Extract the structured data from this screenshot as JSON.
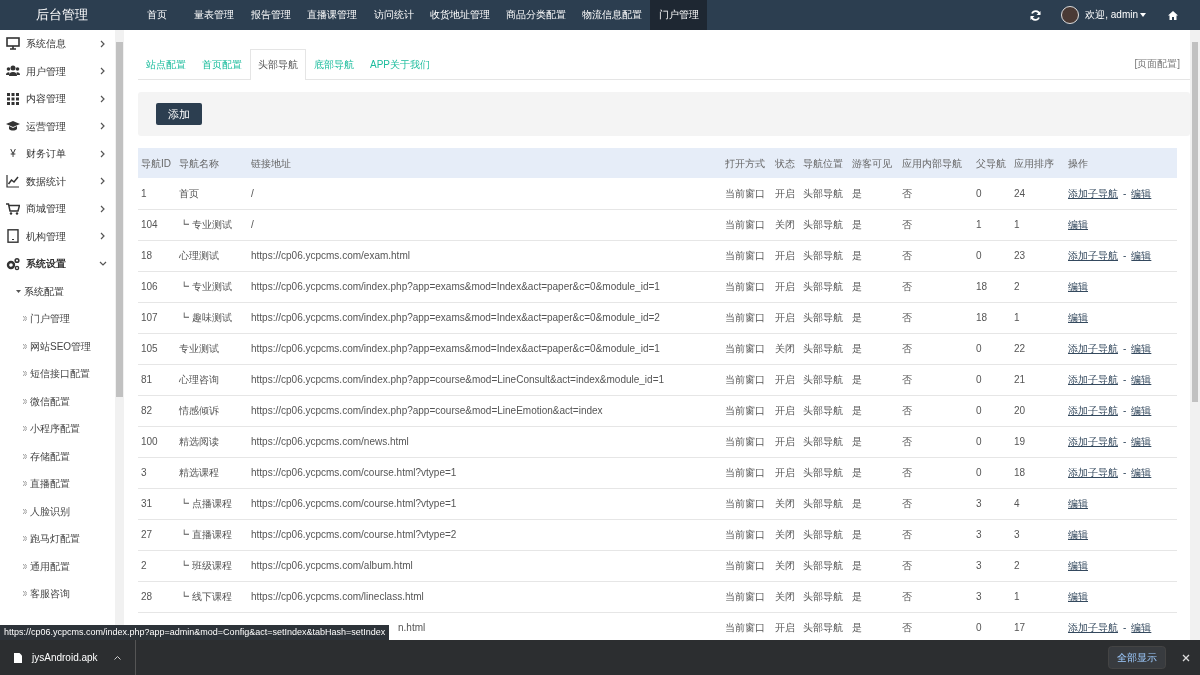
{
  "topbar": {
    "brand": "后台管理",
    "nav": [
      {
        "label": "首页",
        "selected": false
      },
      {
        "label": "量表管理",
        "selected": false
      },
      {
        "label": "报告管理",
        "selected": false
      },
      {
        "label": "直播课管理",
        "selected": false
      },
      {
        "label": "访问统计",
        "selected": false
      },
      {
        "label": "收货地址管理",
        "selected": false
      },
      {
        "label": "商品分类配置",
        "selected": false
      },
      {
        "label": "物流信息配置",
        "selected": false
      },
      {
        "label": "门户管理",
        "selected": true
      }
    ],
    "user": "欢迎, admin"
  },
  "sidebar": {
    "items": [
      {
        "label": "系统信息",
        "expanded": false
      },
      {
        "label": "用户管理",
        "expanded": false
      },
      {
        "label": "内容管理",
        "expanded": false
      },
      {
        "label": "运营管理",
        "expanded": false
      },
      {
        "label": "财务订单",
        "expanded": false,
        "glyph": "¥"
      },
      {
        "label": "数据统计",
        "expanded": false
      },
      {
        "label": "商城管理",
        "expanded": false
      },
      {
        "label": "机构管理",
        "expanded": false
      },
      {
        "label": "系统设置",
        "expanded": true,
        "children": [
          {
            "label": "系统配置",
            "expanded": true,
            "children": [
              {
                "label": "门户管理"
              },
              {
                "label": "网站SEO管理"
              },
              {
                "label": "短信接口配置"
              },
              {
                "label": "微信配置"
              },
              {
                "label": "小程序配置"
              },
              {
                "label": "存储配置"
              },
              {
                "label": "直播配置"
              },
              {
                "label": "人脸识别"
              },
              {
                "label": "跑马灯配置"
              },
              {
                "label": "通用配置"
              },
              {
                "label": "客服咨询"
              }
            ]
          }
        ]
      }
    ]
  },
  "tabs": [
    {
      "label": "站点配置",
      "selected": false
    },
    {
      "label": "首页配置",
      "selected": false
    },
    {
      "label": "头部导航",
      "selected": true
    },
    {
      "label": "底部导航",
      "selected": false
    },
    {
      "label": "APP关于我们",
      "selected": false
    }
  ],
  "page_config": "[页面配置]",
  "add_button": "添加",
  "table": {
    "columns": [
      "导航ID",
      "导航名称",
      "链接地址",
      "打开方式",
      "状态",
      "导航位置",
      "游客可见",
      "应用内部导航",
      "父导航",
      "应用排序",
      "操作"
    ],
    "separator": "-",
    "rows": [
      {
        "id": "1",
        "name": "首页",
        "link": "/",
        "open": "当前窗口",
        "status": "开启",
        "position": "头部导航",
        "guest": "是",
        "internal": "否",
        "parent": "0",
        "order": "24",
        "actions": [
          "添加子导航",
          "编辑"
        ],
        "children": [
          {
            "id": "104",
            "name": "┗ 专业测试",
            "link": "/",
            "open": "当前窗口",
            "status": "关闭",
            "position": "头部导航",
            "guest": "是",
            "internal": "否",
            "parent": "1",
            "order": "1",
            "actions": [
              "编辑"
            ]
          }
        ]
      },
      {
        "id": "18",
        "name": "心理测试",
        "link": "https://cp06.ycpcms.com/exam.html",
        "open": "当前窗口",
        "status": "开启",
        "position": "头部导航",
        "guest": "是",
        "internal": "否",
        "parent": "0",
        "order": "23",
        "actions": [
          "添加子导航",
          "编辑"
        ],
        "children": [
          {
            "id": "106",
            "name": "┗ 专业测试",
            "link": "https://cp06.ycpcms.com/index.php?app=exams&mod=Index&act=paper&c=0&module_id=1",
            "open": "当前窗口",
            "status": "开启",
            "position": "头部导航",
            "guest": "是",
            "internal": "否",
            "parent": "18",
            "order": "2",
            "actions": [
              "编辑"
            ]
          },
          {
            "id": "107",
            "name": "┗ 趣味测试",
            "link": "https://cp06.ycpcms.com/index.php?app=exams&mod=Index&act=paper&c=0&module_id=2",
            "open": "当前窗口",
            "status": "开启",
            "position": "头部导航",
            "guest": "是",
            "internal": "否",
            "parent": "18",
            "order": "1",
            "actions": [
              "编辑"
            ]
          }
        ]
      },
      {
        "id": "105",
        "name": "专业测试",
        "link": "https://cp06.ycpcms.com/index.php?app=exams&mod=Index&act=paper&c=0&module_id=1",
        "open": "当前窗口",
        "status": "关闭",
        "position": "头部导航",
        "guest": "是",
        "internal": "否",
        "parent": "0",
        "order": "22",
        "actions": [
          "添加子导航",
          "编辑"
        ]
      },
      {
        "id": "81",
        "name": "心理咨询",
        "link": "https://cp06.ycpcms.com/index.php?app=course&mod=LineConsult&act=index&module_id=1",
        "open": "当前窗口",
        "status": "开启",
        "position": "头部导航",
        "guest": "是",
        "internal": "否",
        "parent": "0",
        "order": "21",
        "actions": [
          "添加子导航",
          "编辑"
        ]
      },
      {
        "id": "82",
        "name": "情感倾诉",
        "link": "https://cp06.ycpcms.com/index.php?app=course&mod=LineEmotion&act=index",
        "open": "当前窗口",
        "status": "开启",
        "position": "头部导航",
        "guest": "是",
        "internal": "否",
        "parent": "0",
        "order": "20",
        "actions": [
          "添加子导航",
          "编辑"
        ]
      },
      {
        "id": "100",
        "name": "精选阅读",
        "link": "https://cp06.ycpcms.com/news.html",
        "open": "当前窗口",
        "status": "开启",
        "position": "头部导航",
        "guest": "是",
        "internal": "否",
        "parent": "0",
        "order": "19",
        "actions": [
          "添加子导航",
          "编辑"
        ]
      },
      {
        "id": "3",
        "name": "精选课程",
        "link": "https://cp06.ycpcms.com/course.html?vtype=1",
        "open": "当前窗口",
        "status": "开启",
        "position": "头部导航",
        "guest": "是",
        "internal": "否",
        "parent": "0",
        "order": "18",
        "actions": [
          "添加子导航",
          "编辑"
        ],
        "children": [
          {
            "id": "31",
            "name": "┗ 点播课程",
            "link": "https://cp06.ycpcms.com/course.html?vtype=1",
            "open": "当前窗口",
            "status": "关闭",
            "position": "头部导航",
            "guest": "是",
            "internal": "否",
            "parent": "3",
            "order": "4",
            "actions": [
              "编辑"
            ]
          },
          {
            "id": "27",
            "name": "┗ 直播课程",
            "link": "https://cp06.ycpcms.com/course.html?vtype=2",
            "open": "当前窗口",
            "status": "关闭",
            "position": "头部导航",
            "guest": "是",
            "internal": "否",
            "parent": "3",
            "order": "3",
            "actions": [
              "编辑"
            ]
          },
          {
            "id": "2",
            "name": "┗ 班级课程",
            "link": "https://cp06.ycpcms.com/album.html",
            "open": "当前窗口",
            "status": "关闭",
            "position": "头部导航",
            "guest": "是",
            "internal": "否",
            "parent": "3",
            "order": "2",
            "actions": [
              "编辑"
            ]
          },
          {
            "id": "28",
            "name": "┗ 线下课程",
            "link": "https://cp06.ycpcms.com/lineclass.html",
            "open": "当前窗口",
            "status": "关闭",
            "position": "头部导航",
            "guest": "是",
            "internal": "否",
            "parent": "3",
            "order": "1",
            "actions": [
              "编辑"
            ]
          }
        ]
      }
    ],
    "partial_row": {
      "link": "n.html",
      "open": "当前窗口",
      "status": "开启",
      "position": "头部导航",
      "guest": "是",
      "internal": "否",
      "parent": "0",
      "order": "17",
      "actions": [
        "添加子导航",
        "编辑"
      ]
    }
  },
  "link_tooltip": "https://cp06.ycpcms.com/index.php?app=admin&mod=Config&act=setIndex&tabHash=setIndex",
  "download_bar": {
    "file": "jysAndroid.apk",
    "show_all": "全部显示"
  }
}
